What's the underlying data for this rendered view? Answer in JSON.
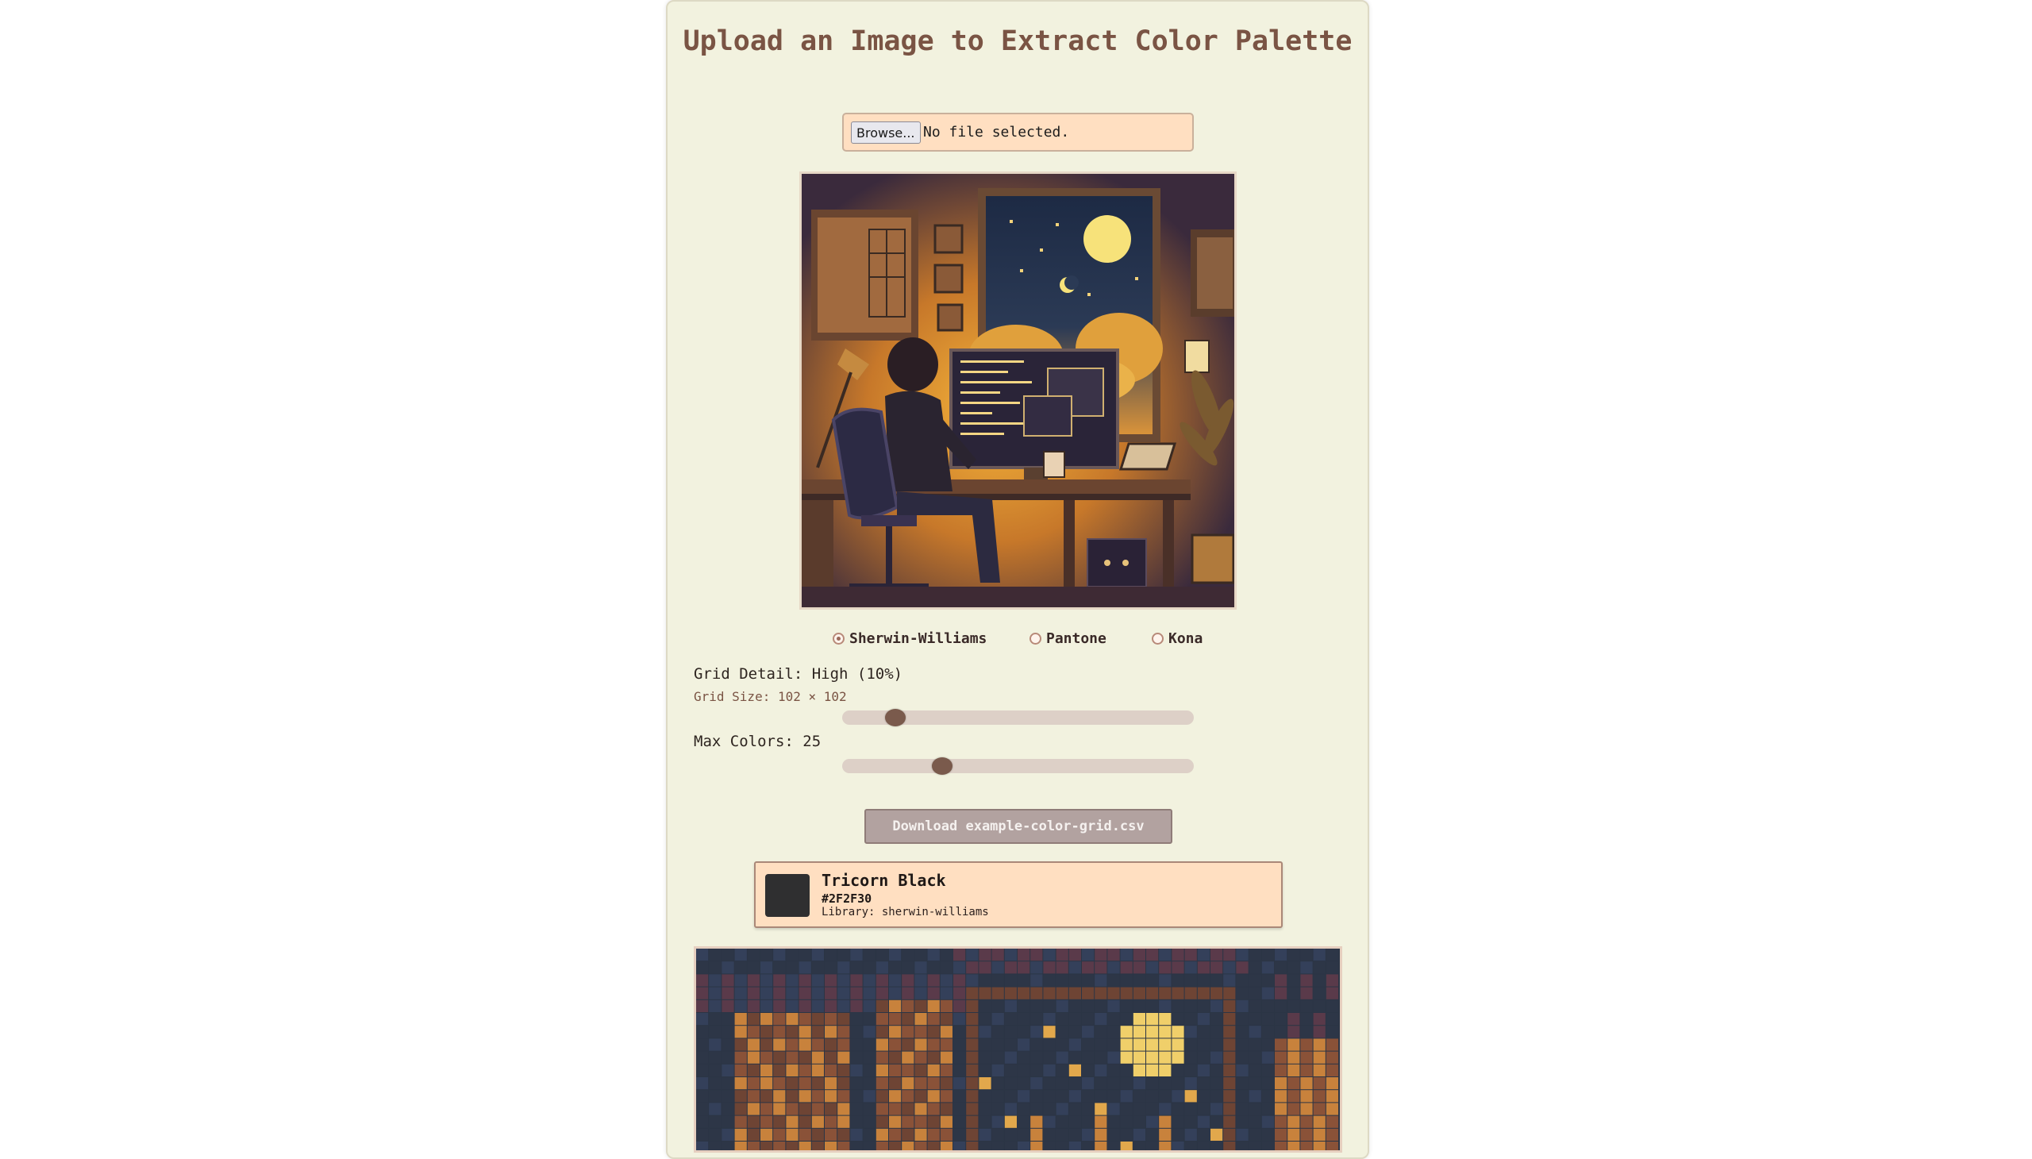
{
  "header": {
    "title": "Upload an Image to Extract Color Palette"
  },
  "upload": {
    "browse_label": "Browse...",
    "status": "No file selected."
  },
  "libraries": [
    {
      "label": "Sherwin-Williams",
      "selected": true
    },
    {
      "label": "Pantone",
      "selected": false
    },
    {
      "label": "Kona",
      "selected": false
    }
  ],
  "controls": {
    "grid_detail_label": "Grid Detail: High (10%)",
    "grid_size_label": "Grid Size: 102 × 102",
    "grid_detail_level": 0.13,
    "max_colors_label": "Max Colors: 25",
    "max_colors_level": 0.27
  },
  "download": {
    "label": "Download example-color-grid.csv"
  },
  "selected_color": {
    "name": "Tricorn Black",
    "hex": "#2F2F30",
    "library": "Library: sherwin-williams"
  },
  "colors": {
    "accent": "#7a5444",
    "panel_bg": "#f2f2df",
    "card_bg": "#ffdfc1",
    "swatch": "#2F2F30"
  }
}
